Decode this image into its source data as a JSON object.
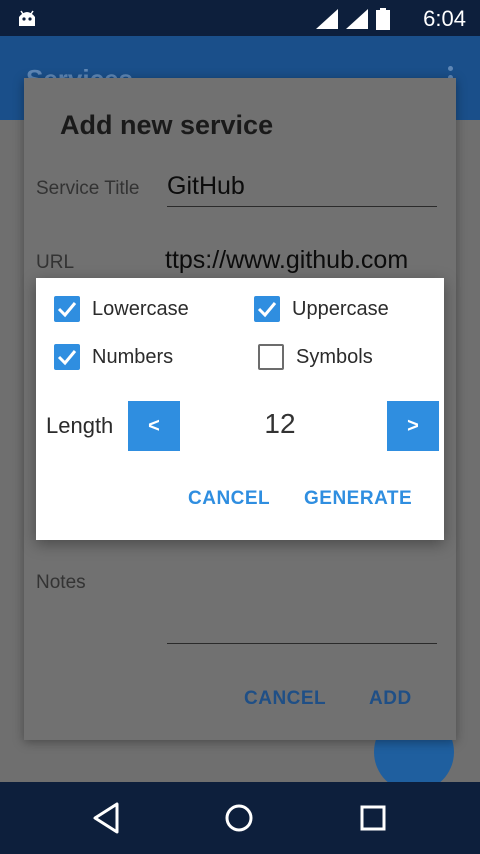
{
  "status_bar": {
    "time": "6:04"
  },
  "app": {
    "toolbar_title": "Services"
  },
  "add_dialog": {
    "title": "Add new service",
    "service_title_label": "Service Title",
    "service_title_value": "GitHub",
    "url_label": "URL",
    "url_value": "ttps://www.github.com",
    "notes_label": "Notes",
    "cancel_label": "CANCEL",
    "add_label": "ADD"
  },
  "generator": {
    "options": [
      {
        "label": "Lowercase",
        "checked": true
      },
      {
        "label": "Uppercase",
        "checked": true
      },
      {
        "label": "Numbers",
        "checked": true
      },
      {
        "label": "Symbols",
        "checked": false
      }
    ],
    "length_label": "Length",
    "length_value": "12",
    "decrease_label": "<",
    "increase_label": ">",
    "cancel_label": "CANCEL",
    "generate_label": "GENERATE"
  },
  "colors": {
    "accent": "#2f8ee0",
    "primary_dark": "#0d1f3c"
  }
}
